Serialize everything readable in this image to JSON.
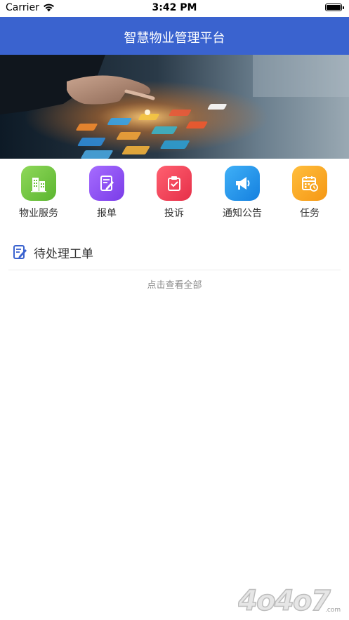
{
  "status_bar": {
    "carrier": "Carrier",
    "time": "3:42 PM"
  },
  "header": {
    "title": "智慧物业管理平台"
  },
  "menu": [
    {
      "label": "物业服务",
      "icon": "building-icon",
      "color": "#7ac943"
    },
    {
      "label": "报单",
      "icon": "document-edit-icon",
      "color": "#8b4cf0"
    },
    {
      "label": "投诉",
      "icon": "complaint-icon",
      "color": "#f0465c"
    },
    {
      "label": "通知公告",
      "icon": "megaphone-icon",
      "color": "#1f96ea"
    },
    {
      "label": "任务",
      "icon": "calendar-clock-icon",
      "color": "#f7a61f"
    }
  ],
  "pending": {
    "title": "待处理工单",
    "view_all": "点击查看全部"
  },
  "watermark": {
    "text": "4o4o7.com"
  },
  "colors": {
    "nav_bar": "#3a63cf",
    "accent": "#3a63cf"
  }
}
